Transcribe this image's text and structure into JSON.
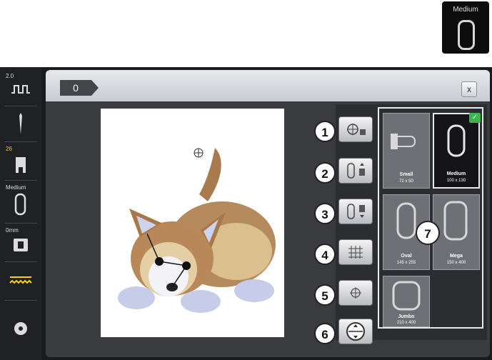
{
  "top_indicator": {
    "label": "Medium",
    "icon": "hoop-icon"
  },
  "sidebar": {
    "items": [
      {
        "label": "2.0",
        "icon": "stitch-width-icon"
      },
      {
        "label": "",
        "icon": "needle-icon"
      },
      {
        "label": "26",
        "icon": "presser-foot-icon"
      },
      {
        "label": "Medium",
        "icon": "hoop-icon"
      },
      {
        "label": "0mm",
        "icon": "stitch-plate-icon"
      },
      {
        "label": "",
        "icon": "thread-tension-icon"
      },
      {
        "label": "",
        "icon": "settings-icon"
      }
    ]
  },
  "window": {
    "hoop_tab_label": "0",
    "close_label": "x"
  },
  "function_buttons": [
    {
      "number": "1",
      "icon": "center-hoop-icon"
    },
    {
      "number": "2",
      "icon": "move-hoop-up-icon"
    },
    {
      "number": "3",
      "icon": "move-hoop-back-icon"
    },
    {
      "number": "4",
      "icon": "grid-icon"
    },
    {
      "number": "5",
      "icon": "center-point-icon"
    },
    {
      "number": "6",
      "icon": "hoop-trace-icon"
    }
  ],
  "callout_7": "7",
  "hoops": [
    {
      "name": "Small",
      "size": "72 x 50",
      "selected": false
    },
    {
      "name": "Medium",
      "size": "100 x 130",
      "selected": true
    },
    {
      "name": "Oval",
      "size": "145 x 255",
      "selected": false
    },
    {
      "name": "Mega",
      "size": "150 x 400",
      "selected": false
    },
    {
      "name": "Jumbo",
      "size": "210 x 400",
      "selected": false
    }
  ],
  "colors": {
    "accent_yellow": "#f2d21a",
    "check_green": "#3bb54a",
    "screen_bg": "#1a1b1e"
  }
}
